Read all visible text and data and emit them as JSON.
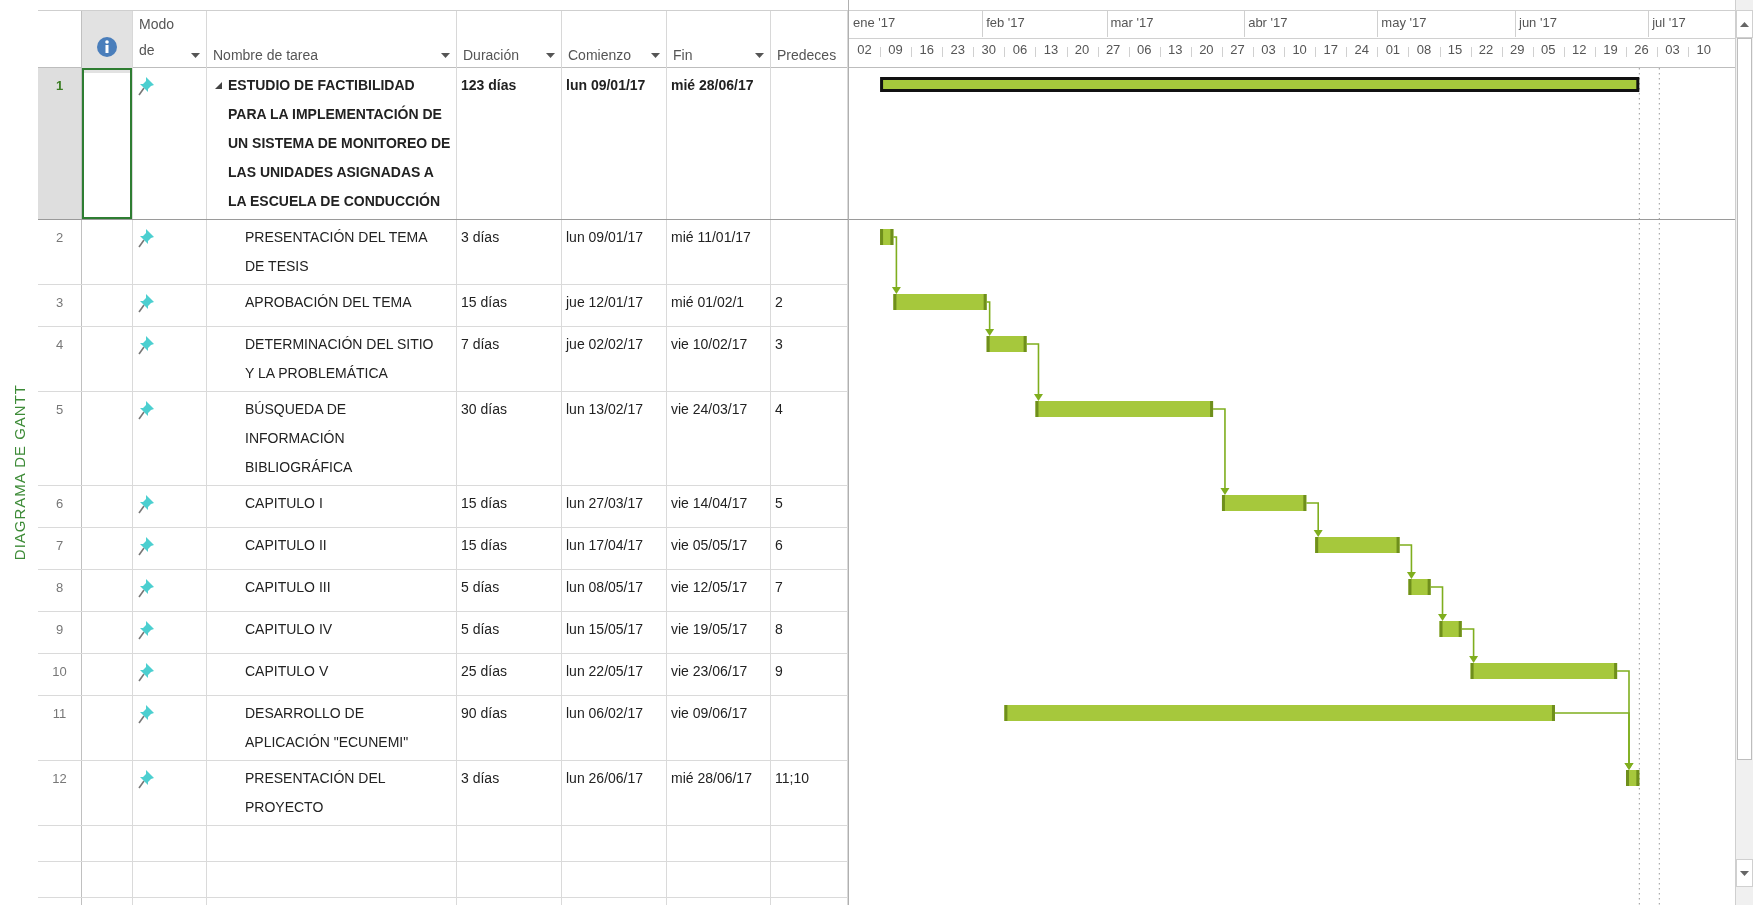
{
  "side_label": "DIAGRAMA DE GANTT",
  "columns": [
    {
      "kind": "indicator"
    },
    {
      "kind": "label",
      "label": "Modo de",
      "filter": true
    },
    {
      "kind": "label",
      "label": "Nombre de tarea",
      "filter": true
    },
    {
      "kind": "label",
      "label": "Duración",
      "filter": true
    },
    {
      "kind": "label",
      "label": "Comienzo",
      "filter": true
    },
    {
      "kind": "label",
      "label": "Fin",
      "filter": true
    },
    {
      "kind": "label",
      "label": "Predeces",
      "filter": false
    }
  ],
  "timescale": {
    "months": [
      "ene '17",
      "feb '17",
      "mar '17",
      "abr '17",
      "may '17",
      "jun '17",
      "jul '17"
    ],
    "weeks": [
      "02",
      "09",
      "16",
      "23",
      "30",
      "06",
      "13",
      "20",
      "27",
      "06",
      "13",
      "20",
      "27",
      "03",
      "10",
      "17",
      "24",
      "01",
      "08",
      "15",
      "22",
      "29",
      "05",
      "12",
      "19",
      "26",
      "03",
      "10"
    ]
  },
  "rows": [
    {
      "id": "1",
      "selected": true,
      "kind": "summary",
      "manual": true,
      "expanded": true,
      "name": "ESTUDIO DE FACTIBILIDAD PARA LA IMPLEMENTACIÓN DE UN SISTEMA DE MONITOREO DE LAS UNIDADES ASIGNADAS A LA ESCUELA DE CONDUCCIÓN",
      "duration": "123 días",
      "start": "lun 09/01/17",
      "finish": "mié 28/06/17"
    },
    {
      "id": "2",
      "selected": false,
      "kind": "task",
      "manual": true,
      "name": "PRESENTACIÓN DEL TEMA DE TESIS",
      "duration": "3 días",
      "start": "lun 09/01/17",
      "finish": "mié 11/01/17"
    },
    {
      "id": "3",
      "selected": false,
      "kind": "task",
      "manual": true,
      "name": "APROBACIÓN DEL TEMA",
      "duration": "15 días",
      "start": "jue 12/01/17",
      "finish": "mié 01/02/1",
      "predecessors": "2"
    },
    {
      "id": "4",
      "selected": false,
      "kind": "task",
      "manual": true,
      "name": "DETERMINACIÓN DEL SITIO Y LA PROBLEMÁTICA",
      "duration": "7 días",
      "start": "jue 02/02/17",
      "finish": "vie 10/02/17",
      "predecessors": "3"
    },
    {
      "id": "5",
      "selected": false,
      "kind": "task",
      "manual": true,
      "name": "BÚSQUEDA DE INFORMACIÓN BIBLIOGRÁFICA",
      "duration": "30 días",
      "start": "lun 13/02/17",
      "finish": "vie 24/03/17",
      "predecessors": "4"
    },
    {
      "id": "6",
      "selected": false,
      "kind": "task",
      "manual": true,
      "name": "CAPITULO I",
      "duration": "15 días",
      "start": "lun 27/03/17",
      "finish": "vie 14/04/17",
      "predecessors": "5"
    },
    {
      "id": "7",
      "selected": false,
      "kind": "task",
      "manual": true,
      "name": "CAPITULO II",
      "duration": "15 días",
      "start": "lun 17/04/17",
      "finish": "vie 05/05/17",
      "predecessors": "6"
    },
    {
      "id": "8",
      "selected": false,
      "kind": "task",
      "manual": true,
      "name": "CAPITULO III",
      "duration": "5 días",
      "start": "lun 08/05/17",
      "finish": "vie 12/05/17",
      "predecessors": "7"
    },
    {
      "id": "9",
      "selected": false,
      "kind": "task",
      "manual": true,
      "name": "CAPITULO IV",
      "duration": "5 días",
      "start": "lun 15/05/17",
      "finish": "vie 19/05/17",
      "predecessors": "8"
    },
    {
      "id": "10",
      "selected": false,
      "kind": "task",
      "manual": true,
      "name": "CAPITULO V",
      "duration": "25 días",
      "start": "lun 22/05/17",
      "finish": "vie 23/06/17",
      "predecessors": "9"
    },
    {
      "id": "11",
      "selected": false,
      "kind": "task",
      "manual": true,
      "name": "DESARROLLO DE APLICACIÓN \"ECUNEMI\"",
      "duration": "90 días",
      "start": "lun 06/02/17",
      "finish": "vie 09/06/17"
    },
    {
      "id": "12",
      "selected": false,
      "kind": "task",
      "manual": true,
      "name": "PRESENTACIÓN DEL PROYECTO",
      "duration": "3 días",
      "start": "lun 26/06/17",
      "finish": "mié 28/06/17",
      "predecessors": "11;10"
    }
  ]
}
